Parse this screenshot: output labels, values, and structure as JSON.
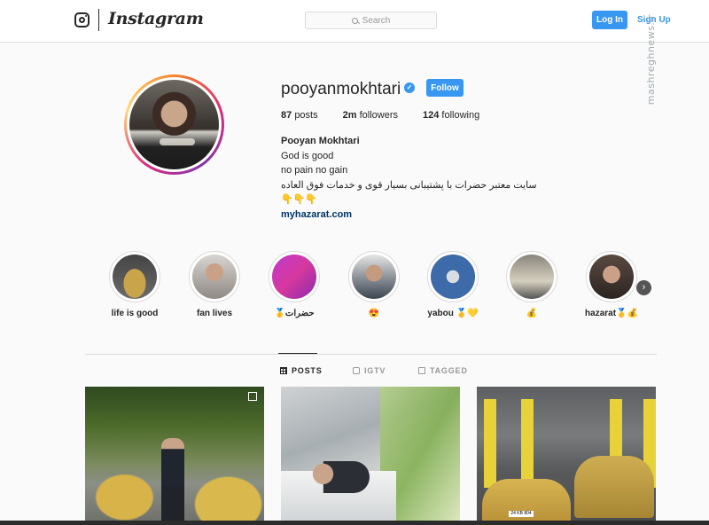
{
  "header": {
    "wordmark": "Instagram",
    "search_placeholder": "Search",
    "login_label": "Log In",
    "signup_label": "Sign Up",
    "watermark": "mashreghnews.ir"
  },
  "profile": {
    "username": "pooyanmokhtari",
    "verified": true,
    "follow_label": "Follow",
    "stats": {
      "posts_count": "87",
      "posts_label": "posts",
      "followers_count": "2m",
      "followers_label": "followers",
      "following_count": "124",
      "following_label": "following"
    },
    "bio": {
      "full_name": "Pooyan Mokhtari",
      "line1": "God is good",
      "line2": "no pain no gain",
      "line3": "سایت معتبر حضرات با پشتیبانی بسیار قوی و خدمات فوق العاده",
      "line4": "👇👇👇",
      "link": "myhazarat.com"
    }
  },
  "highlights": [
    {
      "label": "life is good"
    },
    {
      "label": "fan lives"
    },
    {
      "label": "حضرات🥇"
    },
    {
      "label": "😍"
    },
    {
      "label": "yabou 🥇💛"
    },
    {
      "label": "💰"
    },
    {
      "label": "hazarat🥇💰"
    }
  ],
  "tabs": [
    {
      "label": "POSTS",
      "active": true,
      "icon": "grid-icon"
    },
    {
      "label": "IGTV",
      "active": false,
      "icon": "igtv-icon"
    },
    {
      "label": "TAGGED",
      "active": false,
      "icon": "tag-icon"
    }
  ],
  "colors": {
    "accent": "#3897f0",
    "link": "#003569",
    "text": "#262626",
    "background": "#fafafa"
  },
  "posts": [
    {
      "plate": ""
    },
    {
      "plate": ""
    },
    {
      "plate": "24 KB 804"
    }
  ]
}
